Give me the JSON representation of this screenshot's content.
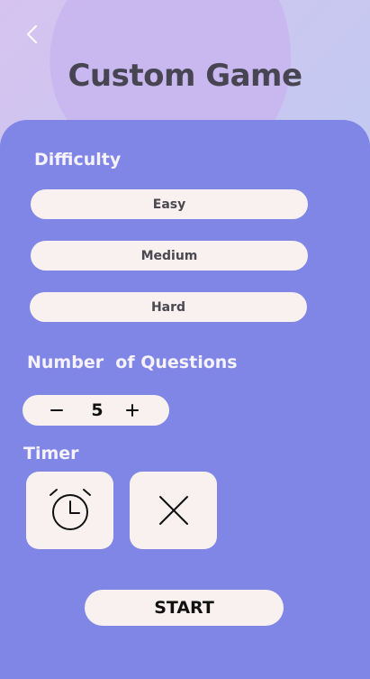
{
  "header": {
    "back_icon": "chevron-left-icon",
    "title": "Custom Game"
  },
  "difficulty": {
    "heading": "Difficulty",
    "options": [
      {
        "label": "Easy"
      },
      {
        "label": "Medium"
      },
      {
        "label": "Hard"
      }
    ]
  },
  "questions": {
    "heading": "Number  of Questions",
    "decrement_icon": "minus-icon",
    "increment_icon": "plus-icon",
    "value": "5"
  },
  "timer": {
    "heading": "Timer",
    "options": [
      {
        "icon": "alarm-clock-icon"
      },
      {
        "icon": "close-icon"
      }
    ]
  },
  "start": {
    "label": "START"
  },
  "colors": {
    "panel": "#7f86e5",
    "pill": "#f8f1f0",
    "heading_text": "#f6f2fb",
    "title_text": "#474552"
  }
}
